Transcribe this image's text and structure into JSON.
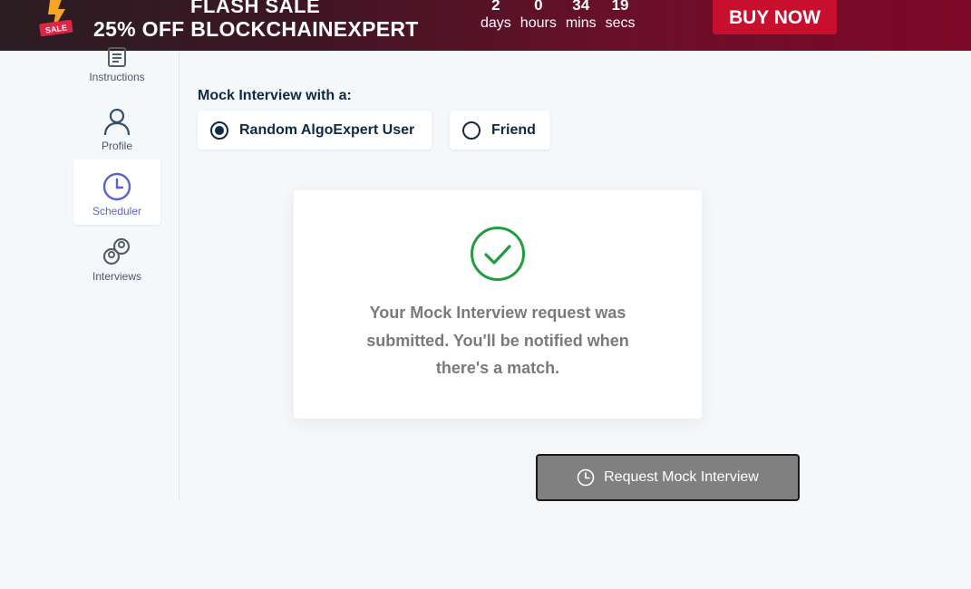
{
  "banner": {
    "logo_text": "SALE",
    "title": "FLASH SALE",
    "promo": "25% OFF BLOCKCHAINEXPERT",
    "countdown": [
      {
        "value": "2",
        "unit": "days"
      },
      {
        "value": "0",
        "unit": "hours"
      },
      {
        "value": "34",
        "unit": "mins"
      },
      {
        "value": "19",
        "unit": "secs"
      }
    ],
    "buy_label": "BUY NOW"
  },
  "sidebar": {
    "items": [
      {
        "label": "Instructions",
        "icon": "document-icon"
      },
      {
        "label": "Profile",
        "icon": "user-icon"
      },
      {
        "label": "Scheduler",
        "icon": "clock-icon",
        "active": true
      },
      {
        "label": "Interviews",
        "icon": "people-icon"
      }
    ]
  },
  "main": {
    "mock_label": "Mock Interview with a:",
    "options": [
      {
        "label": "Random AlgoExpert User",
        "selected": true
      },
      {
        "label": "Friend",
        "selected": false
      }
    ],
    "success_message": "Your Mock Interview request was submitted. You'll be notified when there's a match.",
    "request_button": "Request Mock Interview"
  },
  "colors": {
    "accent": "#5a63c9",
    "success": "#1e9e3e",
    "buy_button": "#c8102e",
    "navy": "#102a43"
  }
}
